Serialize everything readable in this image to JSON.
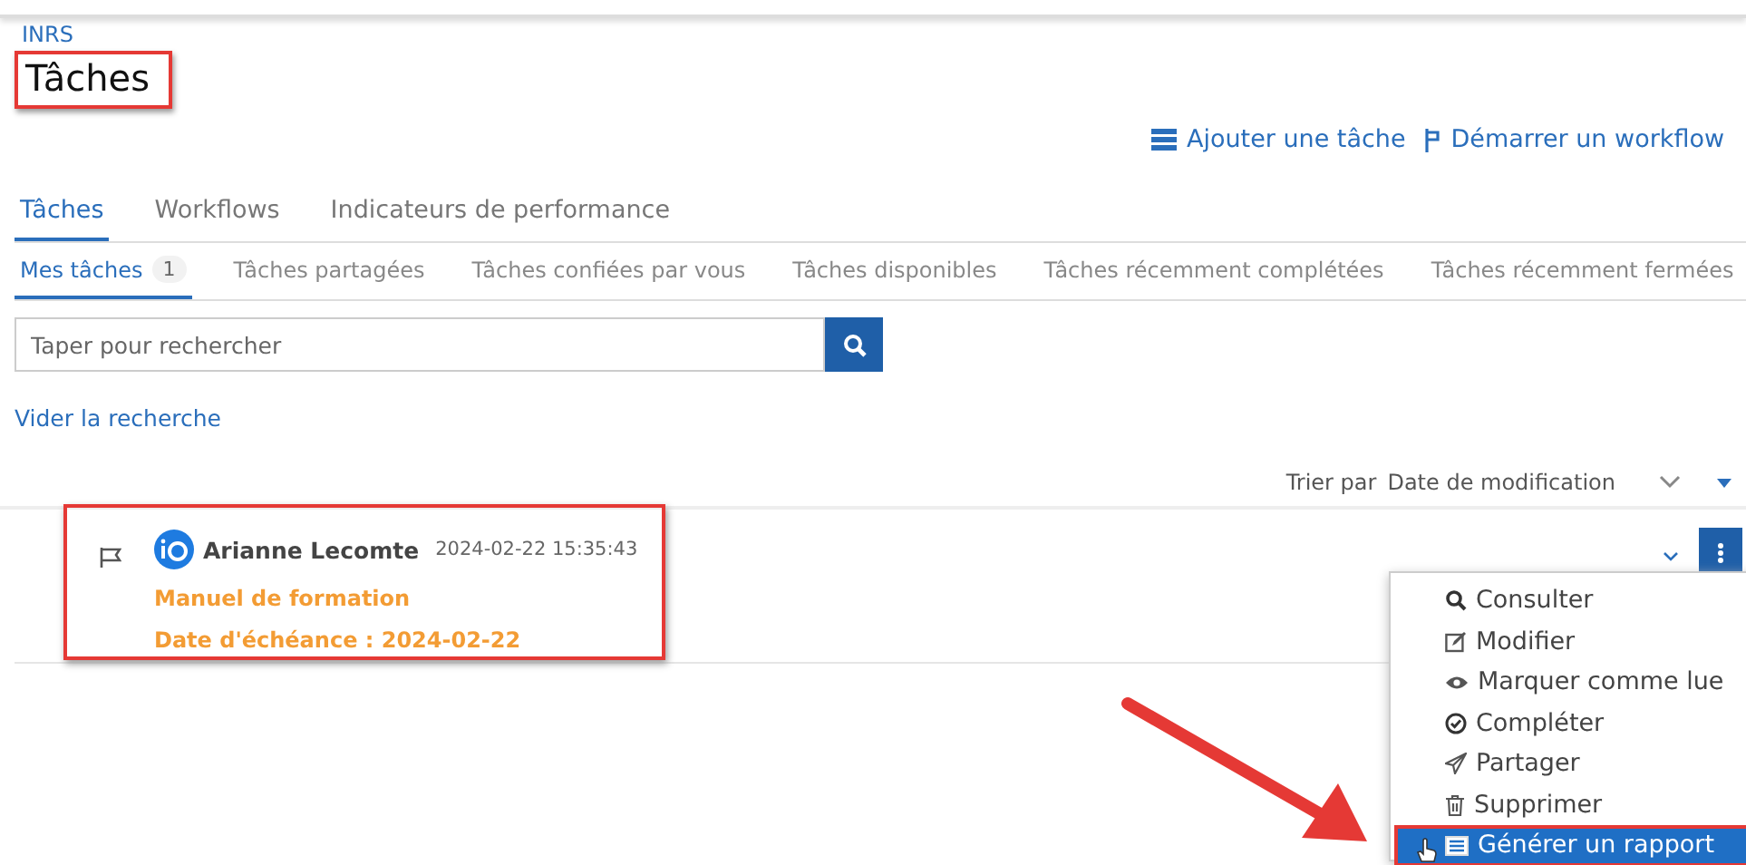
{
  "breadcrumb": [
    "INRS"
  ],
  "title": "Tâches",
  "actions": [
    {
      "kind": "add",
      "label": "Ajouter une tâche"
    },
    {
      "kind": "workflow",
      "label": "Démarrer un workflow"
    }
  ],
  "tabs": [
    {
      "label": "Tâches",
      "selected": true
    },
    {
      "label": "Workflows",
      "selected": false
    },
    {
      "label": "Indicateurs de performance",
      "selected": false
    }
  ],
  "subtabs": [
    {
      "label": "Mes tâches",
      "count": "1",
      "selected": true
    },
    {
      "label": "Tâches partagées",
      "selected": false
    },
    {
      "label": "Tâches confiées par vous",
      "selected": false
    },
    {
      "label": "Tâches disponibles",
      "selected": false
    },
    {
      "label": "Tâches récemment complétées",
      "selected": false
    },
    {
      "label": "Tâches récemment fermées",
      "selected": false
    }
  ],
  "search": {
    "placeholder": "Taper pour rechercher"
  },
  "clear_link": "Vider la recherche",
  "sort": {
    "label": "Trier par",
    "value": "Date de modification"
  },
  "task": {
    "author": "Arianne Lecomte",
    "timestamp": "2024-02-22 15:35:43",
    "title": "Manuel de formation",
    "due": "Date d'échéance : 2024-02-22"
  },
  "menu": [
    {
      "kind": "search",
      "label": "Consulter",
      "selected": false
    },
    {
      "kind": "edit",
      "label": "Modifier",
      "selected": false
    },
    {
      "kind": "eye",
      "label": "Marquer comme lue",
      "selected": false
    },
    {
      "kind": "check",
      "label": "Compléter",
      "selected": false
    },
    {
      "kind": "send",
      "label": "Partager",
      "selected": false
    },
    {
      "kind": "trash",
      "label": "Supprimer",
      "selected": false
    },
    {
      "kind": "report",
      "label": "Générer un rapport",
      "selected": true
    }
  ]
}
